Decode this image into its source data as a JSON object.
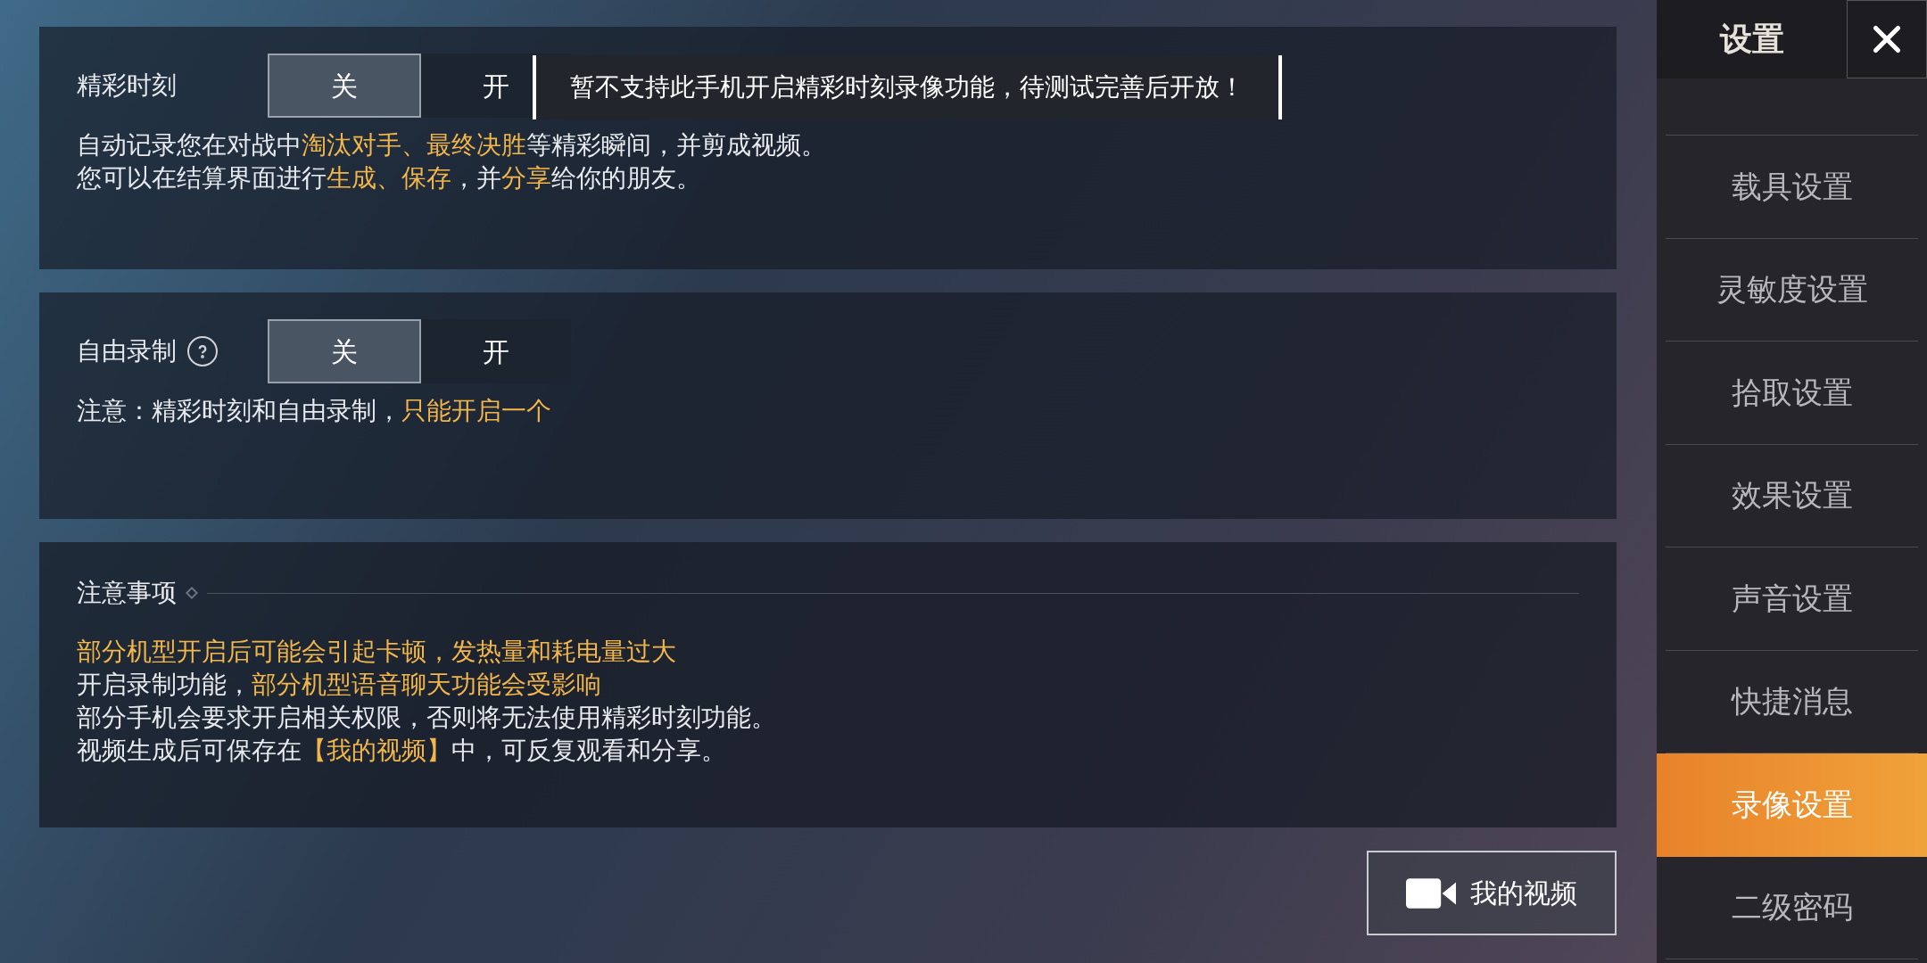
{
  "panels": [
    {
      "kind": "toggle",
      "label": "精彩时刻",
      "help": false,
      "options": [
        {
          "label": "关",
          "selected": true
        },
        {
          "label": "开",
          "selected": false
        }
      ],
      "tooltip": "暂不支持此手机开启精彩时刻录像功能，待测试完善后开放！",
      "lines": [
        [
          {
            "text": "自动记录您在对战中",
            "highlight": false
          },
          {
            "text": "淘汰对手、最终决胜",
            "highlight": true
          },
          {
            "text": "等精彩瞬间，并剪成视频。",
            "highlight": false
          }
        ],
        [
          {
            "text": "您可以在结算界面进行",
            "highlight": false
          },
          {
            "text": "生成、保存",
            "highlight": true
          },
          {
            "text": "，并",
            "highlight": false
          },
          {
            "text": "分享",
            "highlight": true
          },
          {
            "text": "给你的朋友。",
            "highlight": false
          }
        ]
      ]
    },
    {
      "kind": "toggle",
      "label": "自由录制",
      "help": true,
      "options": [
        {
          "label": "关",
          "selected": true
        },
        {
          "label": "开",
          "selected": false
        }
      ],
      "lines": [
        [
          {
            "text": "注意：精彩时刻和自由录制，",
            "highlight": false
          },
          {
            "text": "只能开启一个",
            "highlight": true
          }
        ]
      ]
    },
    {
      "kind": "notes",
      "label": "注意事项",
      "lines": [
        [
          {
            "text": "部分机型开启后可能会引起卡顿，发热量和耗电量过大",
            "highlight": true
          }
        ],
        [
          {
            "text": "开启录制功能，",
            "highlight": false
          },
          {
            "text": "部分机型语音聊天功能会受影响",
            "highlight": true
          }
        ],
        [
          {
            "text": "部分手机会要求开启相关权限，否则将无法使用精彩时刻功能。",
            "highlight": false
          }
        ],
        [
          {
            "text": "视频生成后可保存在",
            "highlight": false
          },
          {
            "text": "【我的视频】",
            "highlight": true
          },
          {
            "text": "中，可反复观看和分享。",
            "highlight": false
          }
        ]
      ]
    }
  ],
  "my_videos_button": "我的视频",
  "sidebar": {
    "title": "设置",
    "items": [
      {
        "label": "载具设置",
        "selected": false
      },
      {
        "label": "灵敏度设置",
        "selected": false
      },
      {
        "label": "拾取设置",
        "selected": false
      },
      {
        "label": "效果设置",
        "selected": false
      },
      {
        "label": "声音设置",
        "selected": false
      },
      {
        "label": "快捷消息",
        "selected": false
      },
      {
        "label": "录像设置",
        "selected": true
      },
      {
        "label": "二级密码",
        "selected": false
      }
    ]
  }
}
